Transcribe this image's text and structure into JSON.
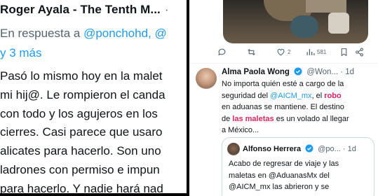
{
  "left_panel": {
    "author_line": "Roger Ayala - The Tenth M...",
    "dot": "·",
    "reply_prefix": "En respuesta a",
    "reply_mentions": "@ponchohd, @",
    "time": "y 3 más",
    "body_lines": [
      "Pasó lo mismo hoy en la malet",
      "mi hij@. Le rompieron el canda",
      "con todo y los agujeros en los",
      "cierres. Casi parece que usaro",
      "alicates para hacerlo. Son uno",
      "ladrones con permiso e impun",
      "para hacerlo. Y nadie hará nad"
    ]
  },
  "right_panel": {
    "actions": {
      "reply_icon": "reply-icon",
      "retweet_icon": "retweet-icon",
      "like_icon": "heart-icon",
      "like_count": "2",
      "views_icon": "views-icon",
      "views_count": "581",
      "bookmark_icon": "bookmark-icon",
      "share_icon": "share-icon"
    },
    "tweet": {
      "name": "Alma Paola Wong",
      "handle": "@Won...",
      "dot": "·",
      "time": "1d",
      "line1": "No importa quién esté a cargo de la",
      "line2_pre": "seguridad del ",
      "line2_mention": "@AICM_mx",
      "line2_mid": ", el ",
      "line2_red": "robo",
      "line3": "en aduanas se mantiene. El destino",
      "line4_pre": "de ",
      "line4_red1": "las",
      "line4_sp": " ",
      "line4_red2": "maletas",
      "line4_post": " es un volado al llegar",
      "line5": "a México..."
    },
    "quote": {
      "name": "Alfonso Herrera",
      "handle": "@po...",
      "dot": "·",
      "time": "1d",
      "lines": [
        "Acabo de regresar de viaje y las",
        "maletas en @AduanasMx del",
        "@AICM_mx las abrieron y se"
      ]
    },
    "colors": {
      "link_blue": "#1d9bf0",
      "highlight_red": "#e0245e",
      "text": "#0f1419",
      "muted": "#536471"
    }
  }
}
